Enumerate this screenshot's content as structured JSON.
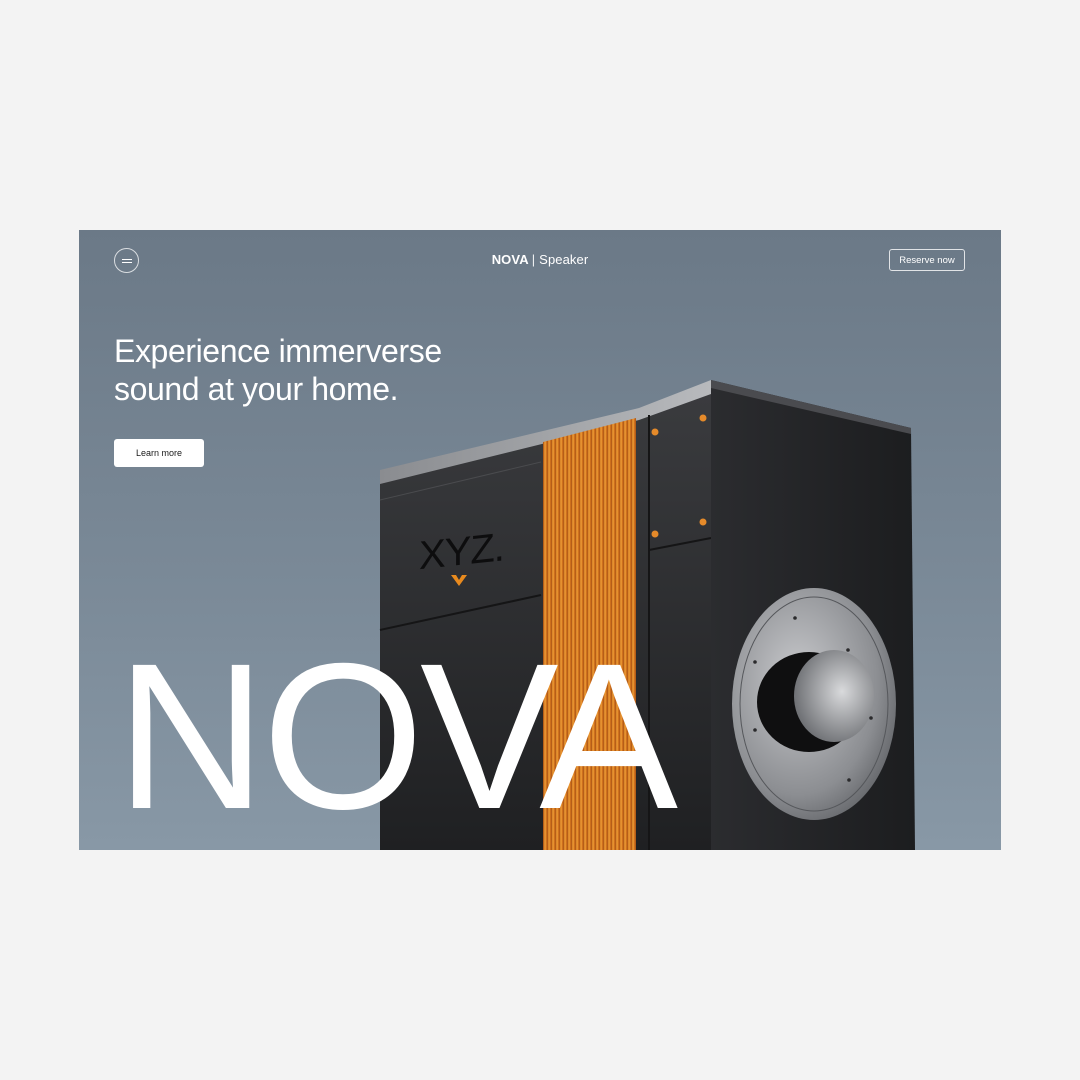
{
  "header": {
    "brand_name": "NOVA",
    "brand_separator": "|",
    "brand_product": "Speaker",
    "reserve_label": "Reserve now",
    "menu_icon": "hamburger-menu-icon"
  },
  "hero": {
    "headline_line1": "Experience immerverse",
    "headline_line2": "sound at your home.",
    "cta_label": "Learn more",
    "big_title": "NOVA"
  },
  "product": {
    "logo_text": "XYZ.",
    "accent_color": "#e88a1e",
    "body_color": "#2a2b2d"
  }
}
